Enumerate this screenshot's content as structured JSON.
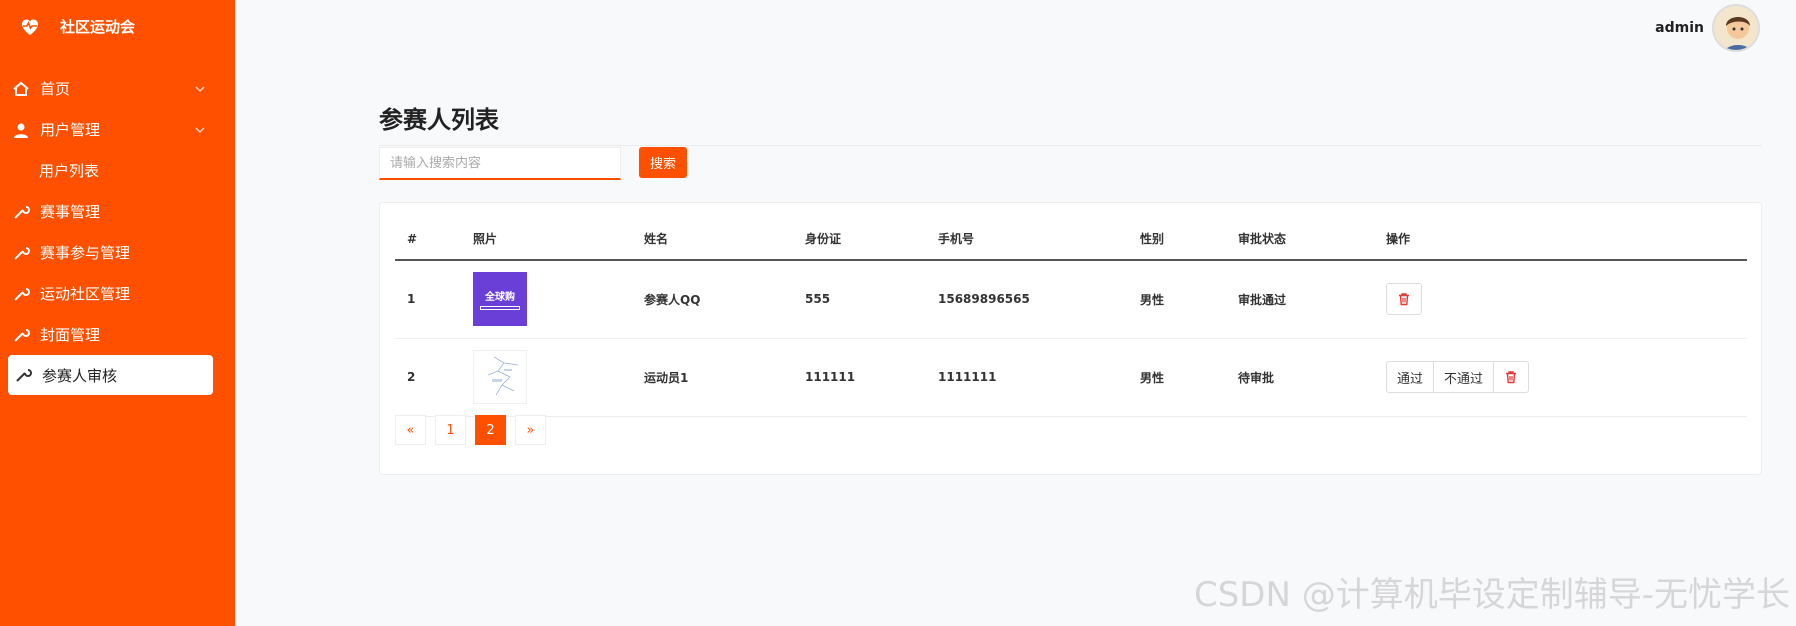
{
  "app": {
    "brand_name": "社区运动会"
  },
  "sidebar": {
    "items": [
      {
        "label": "首页",
        "icon": "home-icon",
        "expandable": true
      },
      {
        "label": "用户管理",
        "icon": "user-icon",
        "expandable": true
      },
      {
        "label": "用户列表",
        "sub": true
      },
      {
        "label": "赛事管理",
        "icon": "wrench-icon"
      },
      {
        "label": "赛事参与管理",
        "icon": "wrench-icon"
      },
      {
        "label": "运动社区管理",
        "icon": "wrench-icon"
      },
      {
        "label": "封面管理",
        "icon": "wrench-icon"
      },
      {
        "label": "参赛人审核",
        "icon": "wrench-icon",
        "active": true
      }
    ]
  },
  "header": {
    "username": "admin"
  },
  "main": {
    "title": "参赛人列表",
    "search": {
      "placeholder": "请输入搜索内容",
      "button": "搜索"
    },
    "table": {
      "headers": [
        "#",
        "照片",
        "姓名",
        "身份证",
        "手机号",
        "性别",
        "审批状态",
        "操作"
      ],
      "rows": [
        {
          "no": "1",
          "photo_text": "全球购",
          "name": "参赛人QQ",
          "id_card": "555",
          "phone": "15689896565",
          "gender": "男性",
          "status": "审批通过",
          "actions": []
        },
        {
          "no": "2",
          "name": "运动员1",
          "id_card": "111111",
          "phone": "1111111",
          "gender": "男性",
          "status": "待审批",
          "actions": [
            "通过",
            "不通过"
          ]
        }
      ]
    },
    "pagination": {
      "prev": "«",
      "pages": [
        "1",
        "2"
      ],
      "current": "2",
      "next": "»"
    }
  },
  "watermark": "CSDN @计算机毕设定制辅导-无忧学长",
  "colors": {
    "primary": "#ff5000",
    "delete": "#e53935"
  }
}
